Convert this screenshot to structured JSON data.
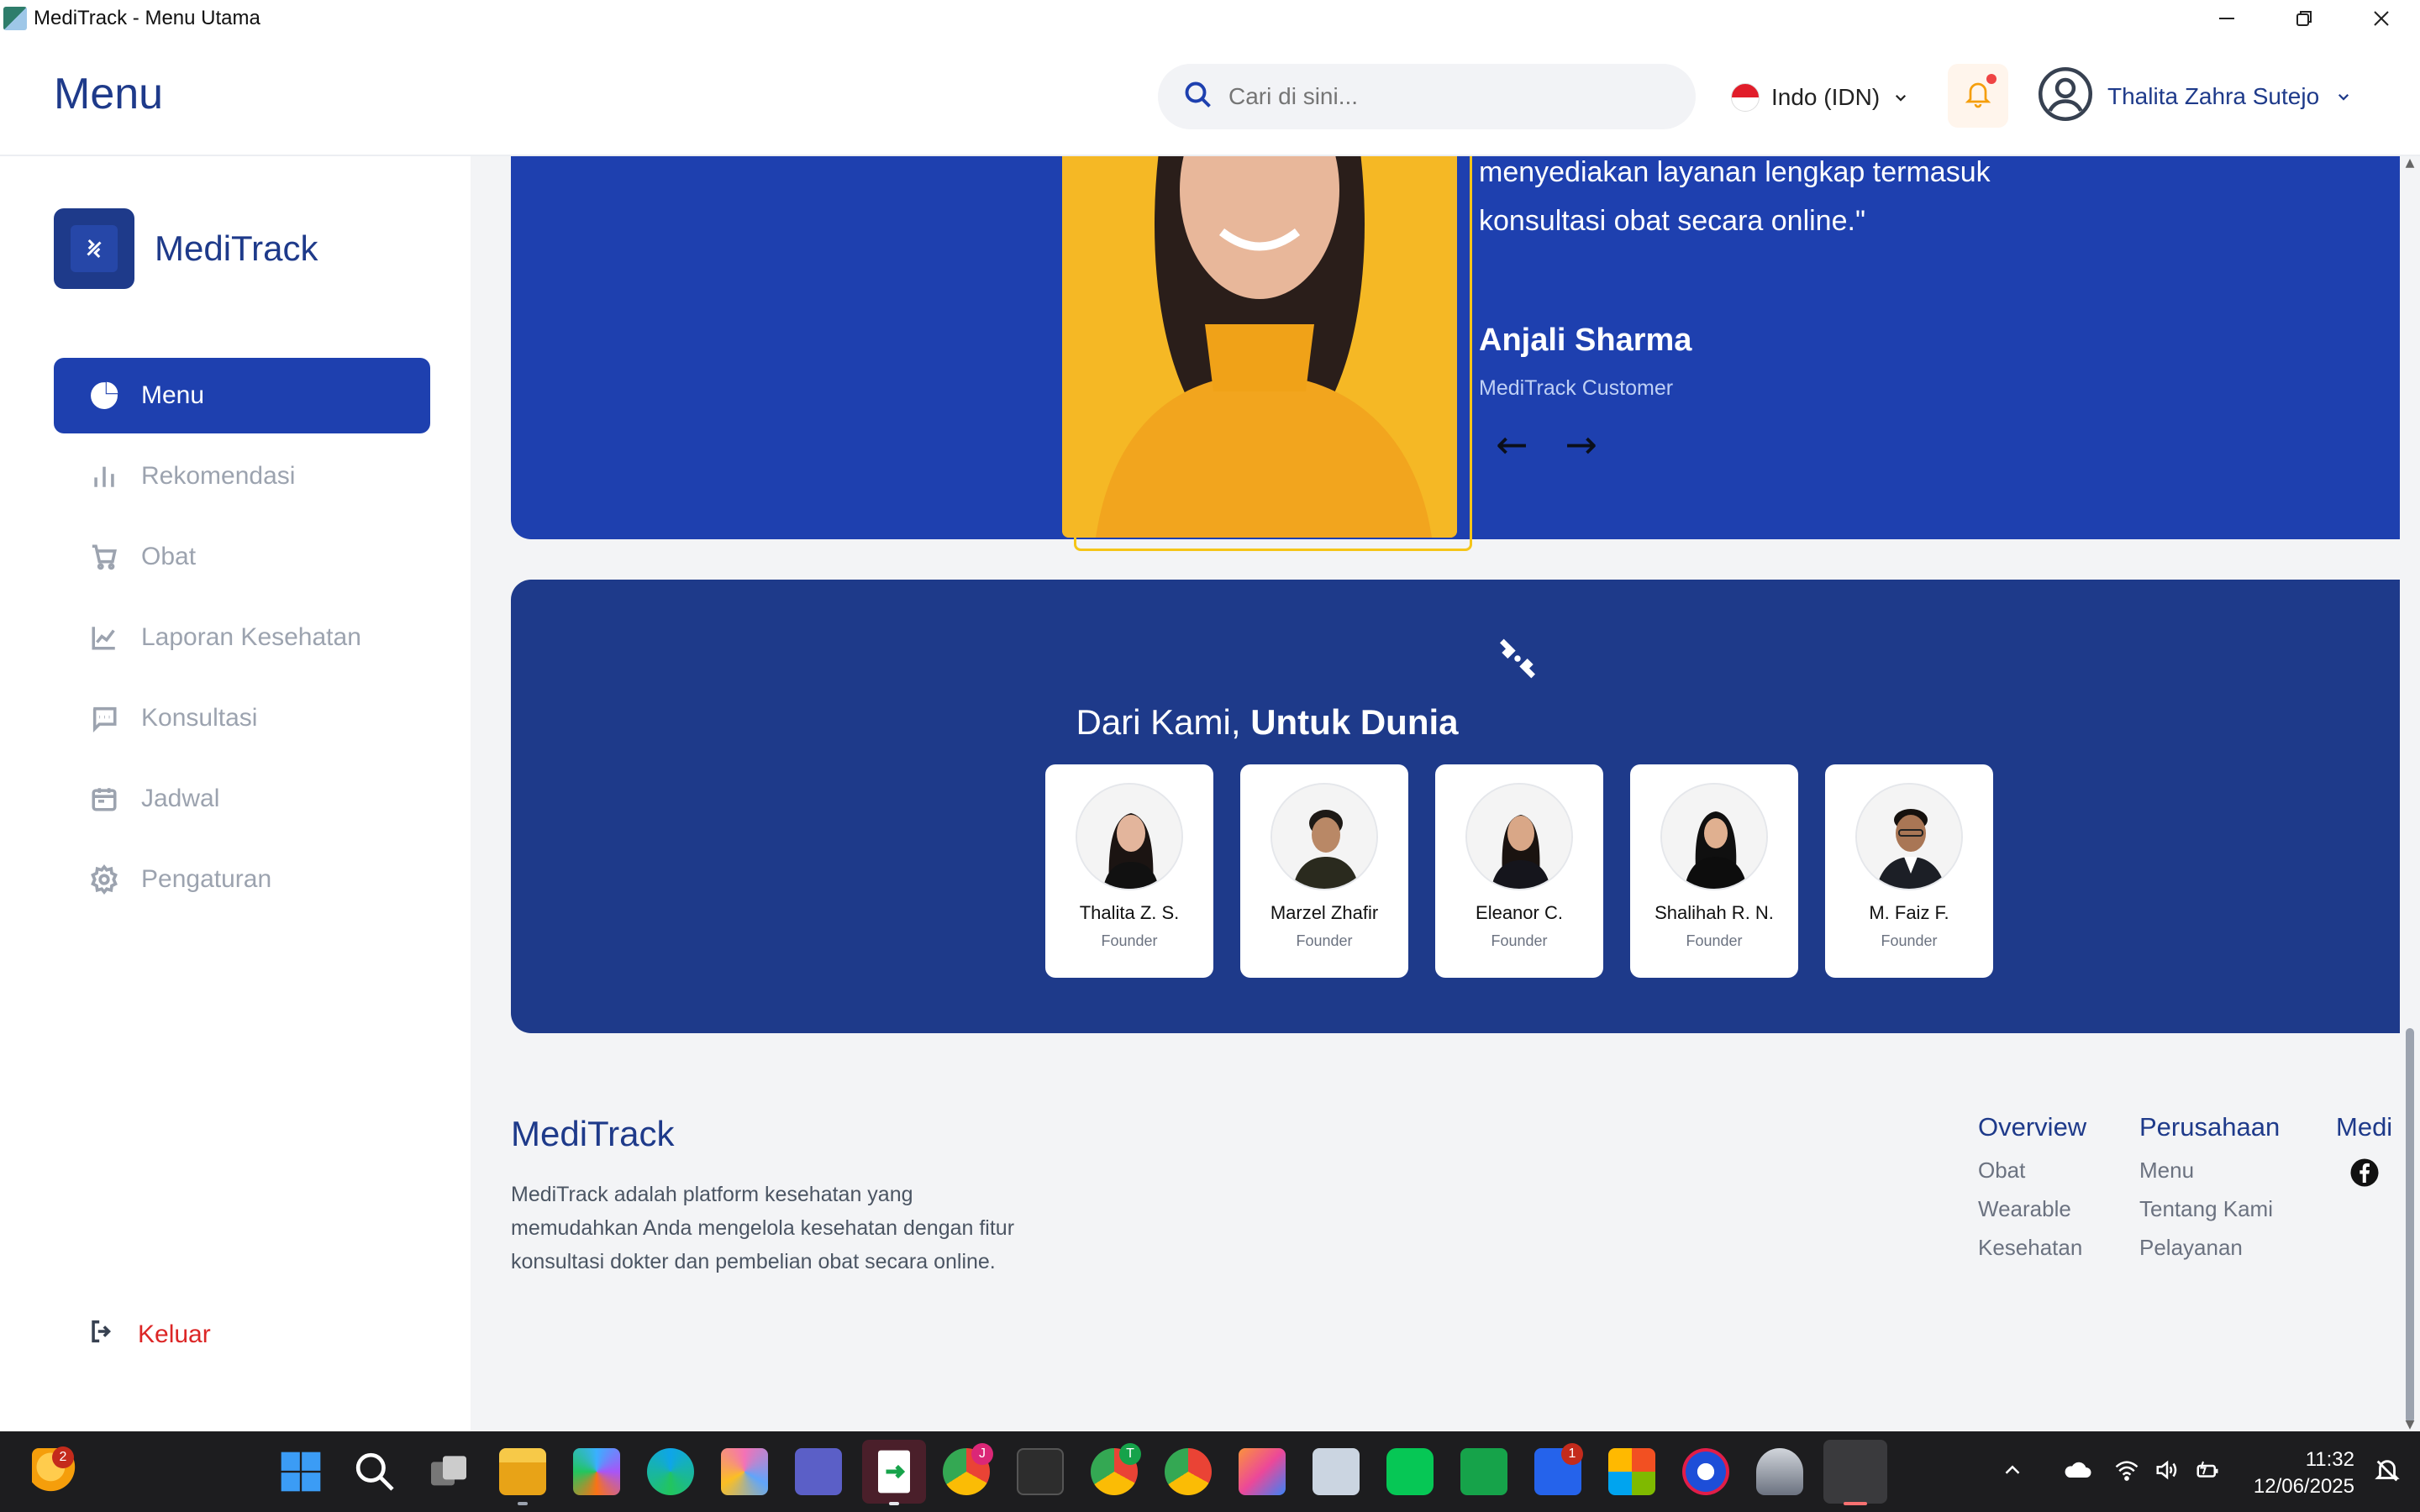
{
  "window": {
    "title": "MediTrack - Menu Utama"
  },
  "header": {
    "page_title": "Menu",
    "search_placeholder": "Cari di sini...",
    "language": "Indo (IDN)",
    "user_name": "Thalita Zahra Sutejo"
  },
  "sidebar": {
    "brand": "MediTrack",
    "items": [
      {
        "label": "Menu",
        "icon": "pie-chart-icon",
        "active": true
      },
      {
        "label": "Rekomendasi",
        "icon": "bar-chart-icon"
      },
      {
        "label": "Obat",
        "icon": "cart-icon"
      },
      {
        "label": "Laporan Kesehatan",
        "icon": "line-chart-icon"
      },
      {
        "label": "Konsultasi",
        "icon": "chat-icon"
      },
      {
        "label": "Jadwal",
        "icon": "calendar-icon"
      },
      {
        "label": "Pengaturan",
        "icon": "gear-icon"
      }
    ],
    "logout": "Keluar"
  },
  "testimonial": {
    "quote": "menyediakan layanan lengkap termasuk konsultasi obat secara online.\"",
    "name": "Anjali Sharma",
    "role": "MediTrack Customer",
    "prev": "←",
    "next": "→"
  },
  "team": {
    "title_regular": "Dari Kami, ",
    "title_bold": "Untuk Dunia",
    "members": [
      {
        "name": "Thalita Z. S.",
        "role": "Founder"
      },
      {
        "name": "Marzel Zhafir",
        "role": "Founder"
      },
      {
        "name": "Eleanor C.",
        "role": "Founder"
      },
      {
        "name": "Shalihah R. N.",
        "role": "Founder"
      },
      {
        "name": "M. Faiz F.",
        "role": "Founder"
      }
    ]
  },
  "footer": {
    "brand": "MediTrack",
    "description": "MediTrack adalah platform kesehatan yang memudahkan Anda mengelola kesehatan dengan fitur konsultasi dokter dan pembelian obat secara online.",
    "columns": [
      {
        "heading": "Overview",
        "links": [
          "Obat",
          "Wearable",
          "Kesehatan"
        ]
      },
      {
        "heading": "Perusahaan",
        "links": [
          "Menu",
          "Tentang Kami",
          "Pelayanan"
        ]
      },
      {
        "heading": "Medi",
        "links": []
      }
    ]
  },
  "taskbar": {
    "time": "11:32",
    "date": "12/06/2025",
    "badges": {
      "weather": "2",
      "chrome_j": "J",
      "chrome_t": "T",
      "app_notif": "1"
    }
  },
  "colors": {
    "primary": "#1e40af",
    "primary_dark": "#1e3a8a",
    "danger": "#dc2626",
    "accent_yellow": "#f5c518"
  }
}
